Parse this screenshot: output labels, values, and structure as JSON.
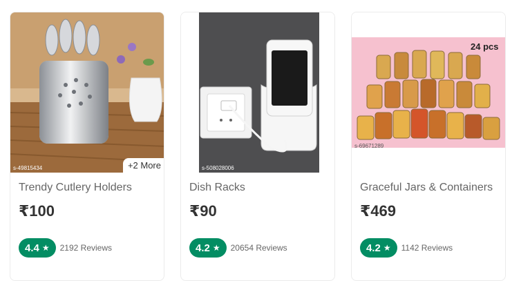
{
  "products": [
    {
      "title": "Trendy Cutlery Holders",
      "price": "₹100",
      "rating": "4.4",
      "reviews": "2192 Reviews",
      "more": "+2 More",
      "watermark": "s-49815434"
    },
    {
      "title": "Dish Racks",
      "price": "₹90",
      "rating": "4.2",
      "reviews": "20654 Reviews",
      "watermark": "s-508028006"
    },
    {
      "title": "Graceful Jars & Containers",
      "price": "₹469",
      "rating": "4.2",
      "reviews": "1142 Reviews",
      "pcs": "24 pcs",
      "watermark": "s-69671289"
    }
  ],
  "icons": {
    "rating": "star-icon"
  },
  "colors": {
    "rating_bg": "#038d63",
    "price": "#333333",
    "title": "#666666"
  }
}
